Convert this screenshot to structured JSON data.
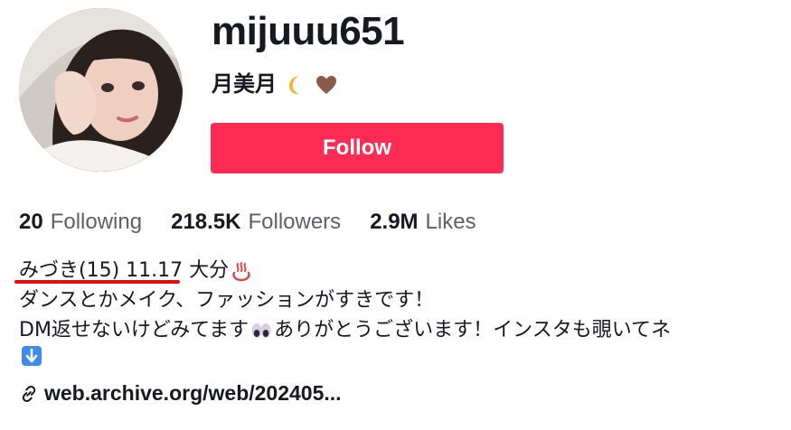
{
  "profile": {
    "username": "mijuuu651",
    "nickname": "月美月",
    "nickname_emojis": [
      "crescent-moon-icon",
      "brown-heart-icon"
    ],
    "follow_label": "Follow"
  },
  "stats": [
    {
      "value": "20",
      "label": "Following"
    },
    {
      "value": "218.5K",
      "label": "Followers"
    },
    {
      "value": "2.9M",
      "label": "Likes"
    }
  ],
  "bio": {
    "line1": "みづき(15) 11.17 大分",
    "line2": "ダンスとかメイク、ファッションがすきです！",
    "line3a": "DM返せないけどみてます",
    "line3b": "ありがとうございます！インスタも覗いてネ"
  },
  "link": {
    "text": "web.archive.org/web/202405..."
  },
  "colors": {
    "follow_button": "#fe2c55",
    "underline_annotation": "#e01010",
    "secondary_text": "#5e606a"
  }
}
